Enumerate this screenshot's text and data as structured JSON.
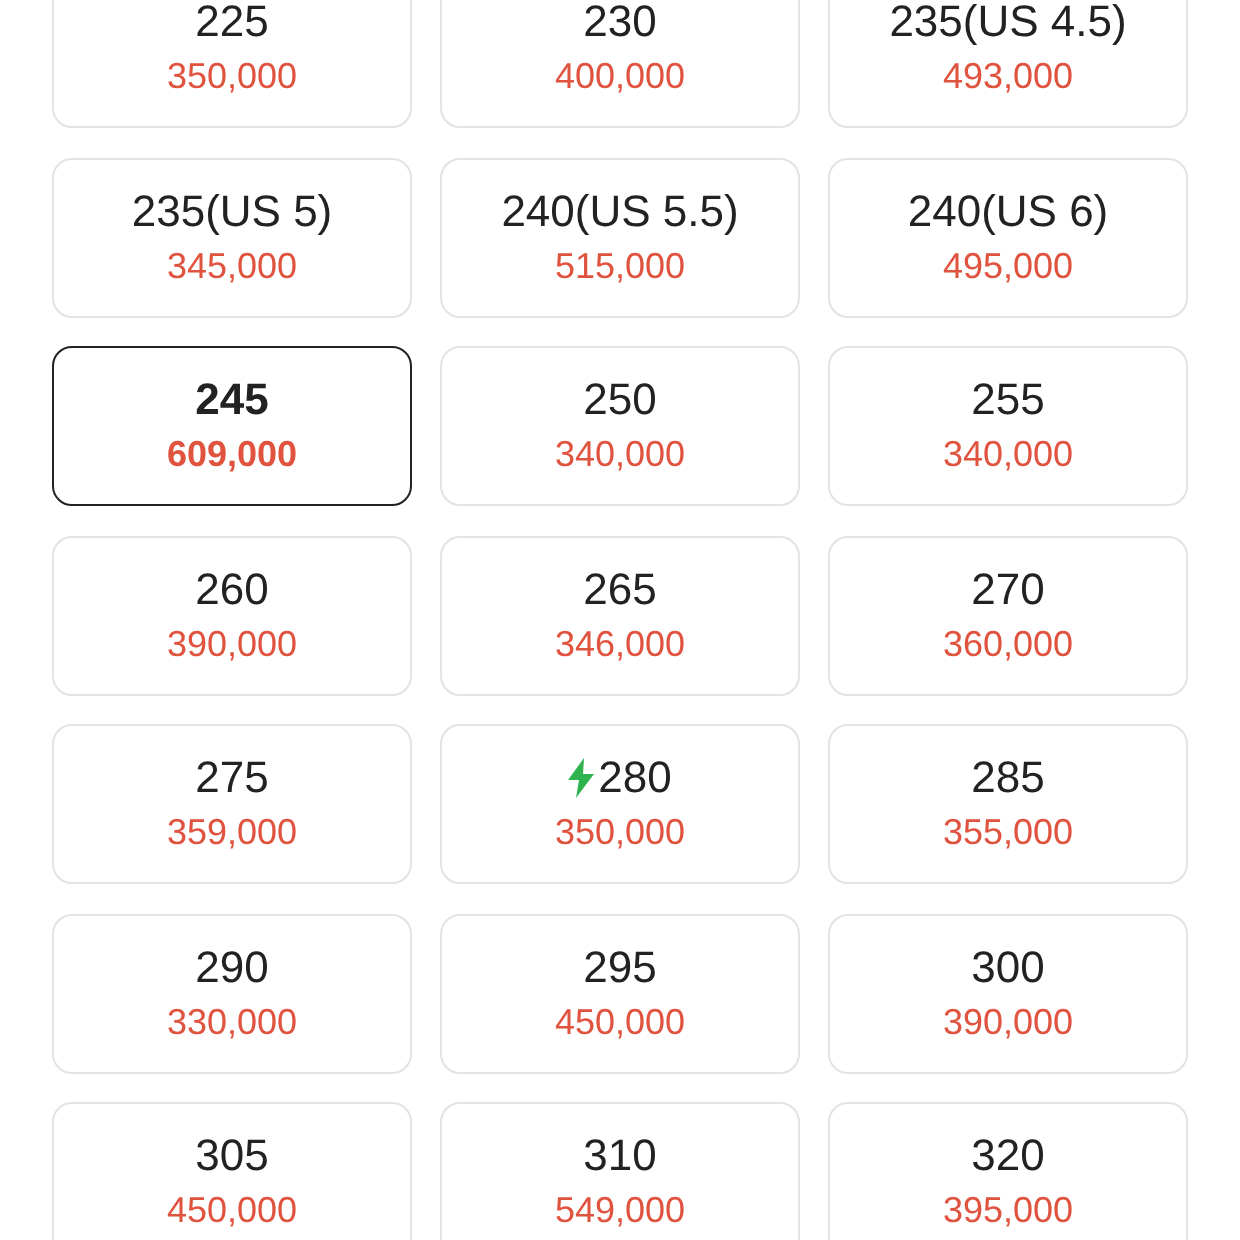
{
  "sizes": [
    {
      "size": "225",
      "price": "350,000",
      "selected": false,
      "express": false
    },
    {
      "size": "230",
      "price": "400,000",
      "selected": false,
      "express": false
    },
    {
      "size": "235(US 4.5)",
      "price": "493,000",
      "selected": false,
      "express": false
    },
    {
      "size": "235(US 5)",
      "price": "345,000",
      "selected": false,
      "express": false
    },
    {
      "size": "240(US 5.5)",
      "price": "515,000",
      "selected": false,
      "express": false
    },
    {
      "size": "240(US 6)",
      "price": "495,000",
      "selected": false,
      "express": false
    },
    {
      "size": "245",
      "price": "609,000",
      "selected": true,
      "express": false
    },
    {
      "size": "250",
      "price": "340,000",
      "selected": false,
      "express": false
    },
    {
      "size": "255",
      "price": "340,000",
      "selected": false,
      "express": false
    },
    {
      "size": "260",
      "price": "390,000",
      "selected": false,
      "express": false
    },
    {
      "size": "265",
      "price": "346,000",
      "selected": false,
      "express": false
    },
    {
      "size": "270",
      "price": "360,000",
      "selected": false,
      "express": false
    },
    {
      "size": "275",
      "price": "359,000",
      "selected": false,
      "express": false
    },
    {
      "size": "280",
      "price": "350,000",
      "selected": false,
      "express": true
    },
    {
      "size": "285",
      "price": "355,000",
      "selected": false,
      "express": false
    },
    {
      "size": "290",
      "price": "330,000",
      "selected": false,
      "express": false
    },
    {
      "size": "295",
      "price": "450,000",
      "selected": false,
      "express": false
    },
    {
      "size": "300",
      "price": "390,000",
      "selected": false,
      "express": false
    },
    {
      "size": "305",
      "price": "450,000",
      "selected": false,
      "express": false
    },
    {
      "size": "310",
      "price": "549,000",
      "selected": false,
      "express": false
    },
    {
      "size": "320",
      "price": "395,000",
      "selected": false,
      "express": false
    }
  ]
}
